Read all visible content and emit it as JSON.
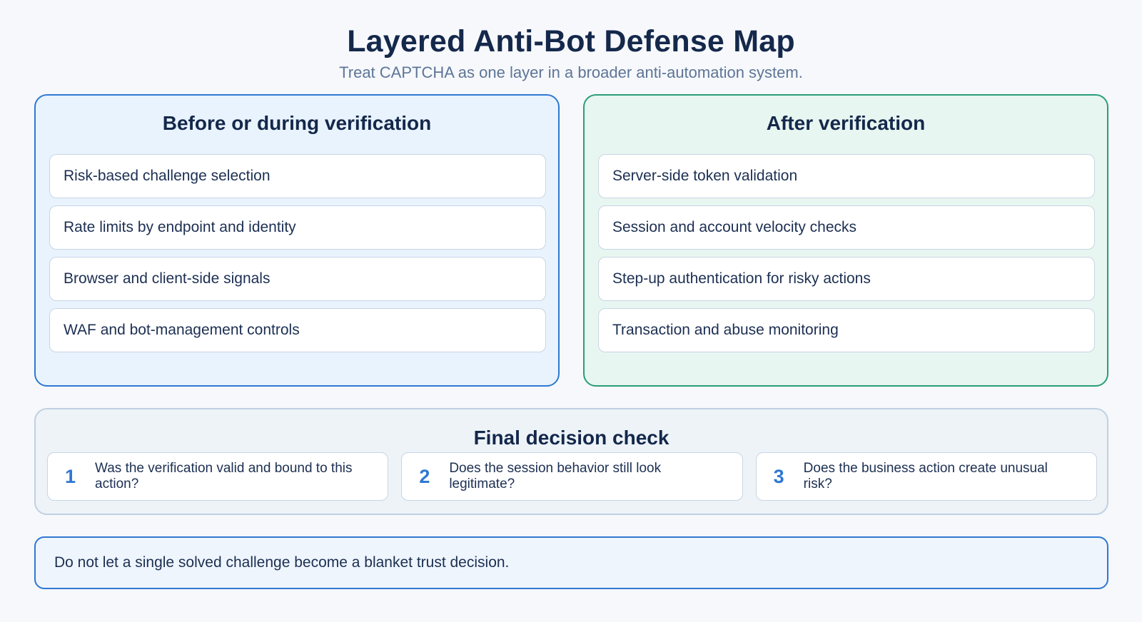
{
  "header": {
    "title": "Layered Anti-Bot Defense Map",
    "subtitle": "Treat CAPTCHA as one layer in a broader anti-automation system."
  },
  "left_panel": {
    "title": "Before or during verification",
    "items": [
      "Risk-based challenge selection",
      "Rate limits by endpoint and identity",
      "Browser and client-side signals",
      "WAF and bot-management controls"
    ]
  },
  "right_panel": {
    "title": "After verification",
    "items": [
      "Server-side token validation",
      "Session and account velocity checks",
      "Step-up authentication for risky actions",
      "Transaction and abuse monitoring"
    ]
  },
  "final_check": {
    "title": "Final decision check",
    "steps": [
      {
        "number": "1",
        "text": "Was the verification valid and bound to this action?"
      },
      {
        "number": "2",
        "text": "Does the session behavior still look legitimate?"
      },
      {
        "number": "3",
        "text": "Does the business action create unusual risk?"
      }
    ]
  },
  "note": "Do not let a single solved challenge become a blanket trust decision.",
  "colors": {
    "left_accent": "#2f78d2",
    "right_accent": "#2a9d78",
    "title_text": "#14284b"
  }
}
